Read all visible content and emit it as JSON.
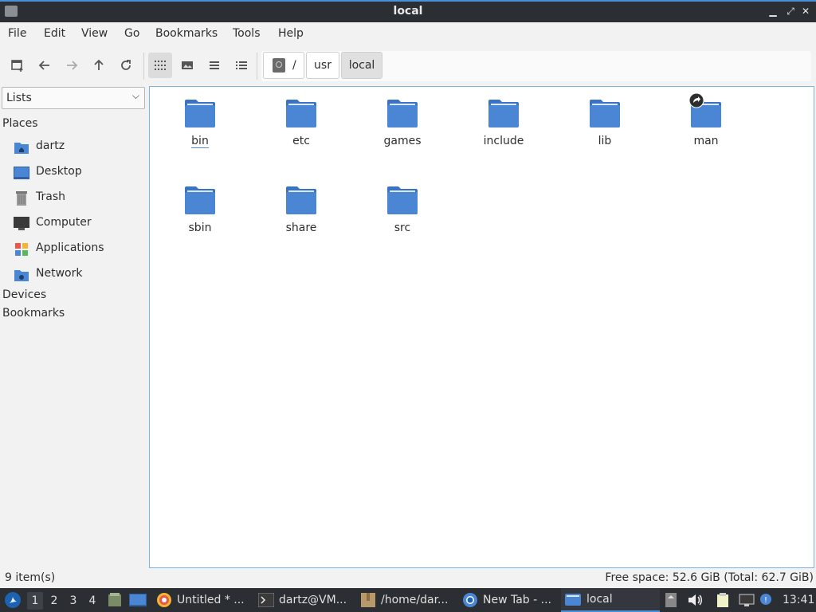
{
  "window": {
    "title": "local"
  },
  "menu": [
    "File",
    "Edit",
    "View",
    "Go",
    "Bookmarks",
    "Tools",
    "Help"
  ],
  "breadcrumbs": [
    "/",
    "usr",
    "local"
  ],
  "sidebar": {
    "selector": "Lists",
    "places_label": "Places",
    "places": [
      {
        "label": "dartz",
        "icon": "home-folder-icon"
      },
      {
        "label": "Desktop",
        "icon": "desktop-icon"
      },
      {
        "label": "Trash",
        "icon": "trash-icon"
      },
      {
        "label": "Computer",
        "icon": "computer-icon"
      },
      {
        "label": "Applications",
        "icon": "applications-icon"
      },
      {
        "label": "Network",
        "icon": "network-icon"
      }
    ],
    "devices_label": "Devices",
    "bookmarks_label": "Bookmarks"
  },
  "files": [
    "bin",
    "etc",
    "games",
    "include",
    "lib",
    "man",
    "sbin",
    "share",
    "src"
  ],
  "status": {
    "items": "9 item(s)",
    "free_space": "Free space: 52.6 GiB (Total: 62.7 GiB)"
  },
  "taskbar": {
    "workspaces": [
      "1",
      "2",
      "3",
      "4"
    ],
    "tasks": [
      "Untitled * ...",
      "dartz@VM...",
      "/home/dar...",
      "New Tab - ...",
      "local"
    ],
    "clock": "13:41"
  },
  "colors": {
    "folder": "#4a86d4",
    "accent": "#4a90d9",
    "panel": "#2b2e33"
  }
}
